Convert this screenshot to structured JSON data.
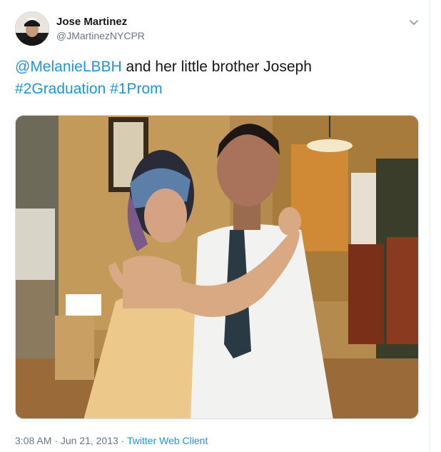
{
  "author": {
    "name": "Jose Martinez",
    "handle": "@JMartinezNYCPR",
    "avatar_icon": "profile-photo"
  },
  "menu": {
    "icon": "chevron-down-icon"
  },
  "tweet": {
    "mention": "@MelanieLBBH",
    "text": " and her little brother Joseph",
    "hashtags": [
      "#2Graduation",
      "#1Prom"
    ]
  },
  "media": {
    "description_icon": "photo"
  },
  "meta": {
    "time": "3:08 AM",
    "separator": " · ",
    "date": "Jun 21, 2013",
    "client": "Twitter Web Client"
  },
  "colors": {
    "link": "#1b95e0",
    "text": "#14171a",
    "secondary": "#657786"
  }
}
